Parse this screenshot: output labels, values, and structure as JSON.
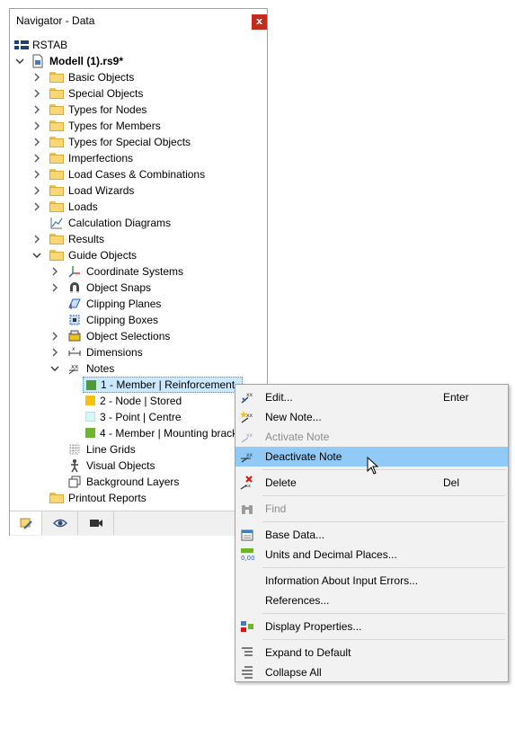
{
  "panel": {
    "title": "Navigator - Data",
    "close_label": "x",
    "colors": {
      "close_bg": "#c42b1c",
      "selection_bg": "#cce8ff",
      "menu_hover": "#91c9f7"
    }
  },
  "tree": {
    "root_label": "RSTAB",
    "model_label": "Modell (1).rs9*",
    "items": [
      {
        "label": "Basic Objects"
      },
      {
        "label": "Special Objects"
      },
      {
        "label": "Types for Nodes"
      },
      {
        "label": "Types for Members"
      },
      {
        "label": "Types for Special Objects"
      },
      {
        "label": "Imperfections"
      },
      {
        "label": "Load Cases & Combinations"
      },
      {
        "label": "Load Wizards"
      },
      {
        "label": "Loads"
      },
      {
        "label": "Calculation Diagrams"
      },
      {
        "label": "Results"
      },
      {
        "label": "Guide Objects"
      }
    ],
    "guide_children": [
      {
        "label": "Coordinate Systems"
      },
      {
        "label": "Object Snaps"
      },
      {
        "label": "Clipping Planes"
      },
      {
        "label": "Clipping Boxes"
      },
      {
        "label": "Object Selections"
      },
      {
        "label": "Dimensions"
      },
      {
        "label": "Notes"
      }
    ],
    "notes": [
      {
        "label": "1 - Member | Reinforcement",
        "color": "#4f9a3a"
      },
      {
        "label": "2 - Node | Stored",
        "color": "#f4c20d"
      },
      {
        "label": "3 - Point | Centre",
        "color": "#d8f8f8"
      },
      {
        "label": "4 - Member | Mounting bracket",
        "color": "#6fb52c"
      }
    ],
    "guide_tail": [
      {
        "label": "Line Grids"
      },
      {
        "label": "Visual Objects"
      },
      {
        "label": "Background Layers"
      }
    ],
    "printout_label": "Printout Reports"
  },
  "menu": {
    "edit": {
      "label": "Edit...",
      "shortcut": "Enter"
    },
    "new_note": {
      "label": "New Note..."
    },
    "activate_note": {
      "label": "Activate Note"
    },
    "deactivate_note": {
      "label": "Deactivate Note"
    },
    "delete": {
      "label": "Delete",
      "shortcut": "Del"
    },
    "find": {
      "label": "Find"
    },
    "base_data": {
      "label": "Base Data..."
    },
    "units": {
      "label": "Units and Decimal Places..."
    },
    "info_errors": {
      "label": "Information About Input Errors..."
    },
    "references": {
      "label": "References..."
    },
    "display_props": {
      "label": "Display Properties..."
    },
    "expand_default": {
      "label": "Expand to Default"
    },
    "collapse_all": {
      "label": "Collapse All"
    },
    "units_icon_text": "0,00"
  }
}
